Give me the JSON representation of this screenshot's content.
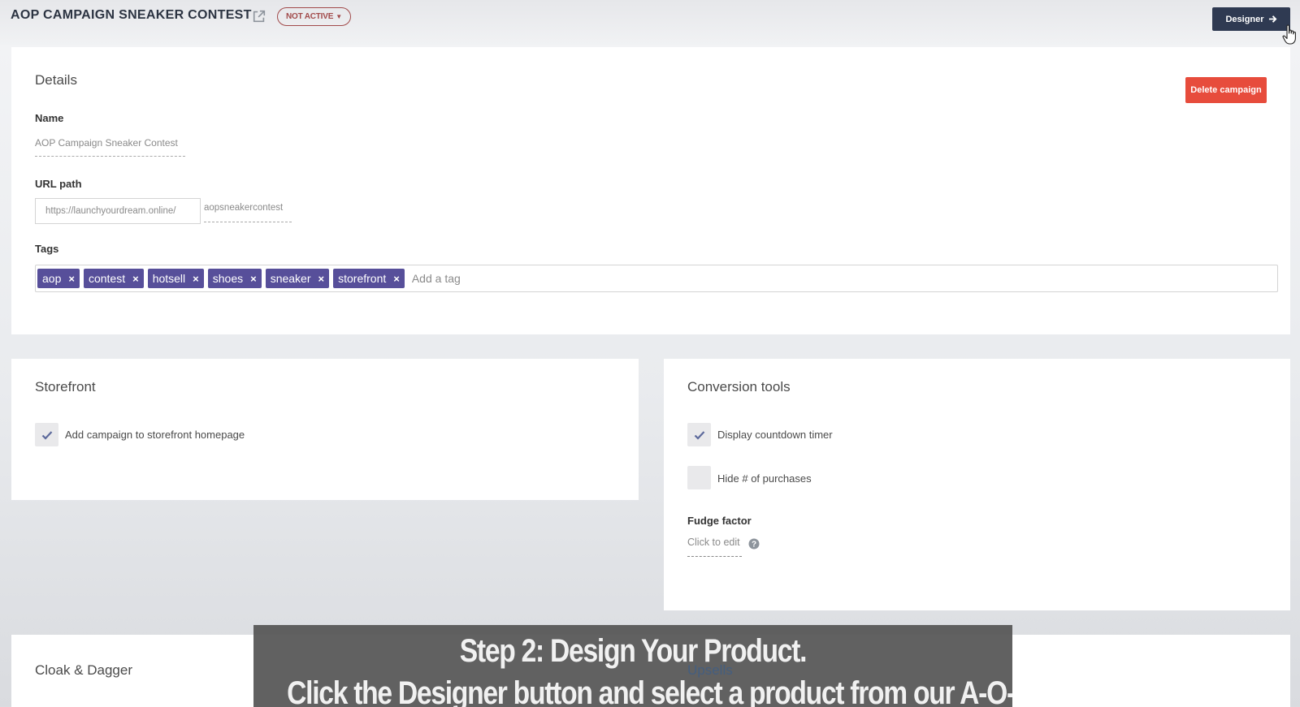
{
  "header": {
    "title": "AOP CAMPAIGN SNEAKER CONTEST",
    "status": "NOT ACTIVE",
    "designer_label": "Designer"
  },
  "details": {
    "title": "Details",
    "delete_label": "Delete campaign",
    "name_label": "Name",
    "name_value": "AOP Campaign Sneaker Contest",
    "url_label": "URL path",
    "url_prefix": "https://launchyourdream.online/",
    "url_slug": "aopsneakercontest",
    "tags_label": "Tags",
    "tags": [
      "aop",
      "contest",
      "hotsell",
      "shoes",
      "sneaker",
      "storefront"
    ],
    "tag_placeholder": "Add a tag"
  },
  "storefront": {
    "title": "Storefront",
    "add_to_homepage": {
      "label": "Add campaign to storefront homepage",
      "checked": true
    }
  },
  "conversion": {
    "title": "Conversion tools",
    "countdown": {
      "label": "Display countdown timer",
      "checked": true
    },
    "hide_purchases": {
      "label": "Hide # of purchases",
      "checked": false
    },
    "fudge_label": "Fudge factor",
    "fudge_value": "Click to edit"
  },
  "cloak": {
    "title": "Cloak & Dagger"
  },
  "upsells": {
    "title": "Upsells"
  },
  "caption": {
    "line1": "Step 2: Design Your Product.",
    "line2": "Click the Designer button and select a product from our A-O-P product line."
  },
  "colors": {
    "designer_bg": "#2f3a52",
    "delete_bg": "#e74c3c",
    "tag_bg": "#574f9a",
    "status_border": "#a14a4a"
  }
}
